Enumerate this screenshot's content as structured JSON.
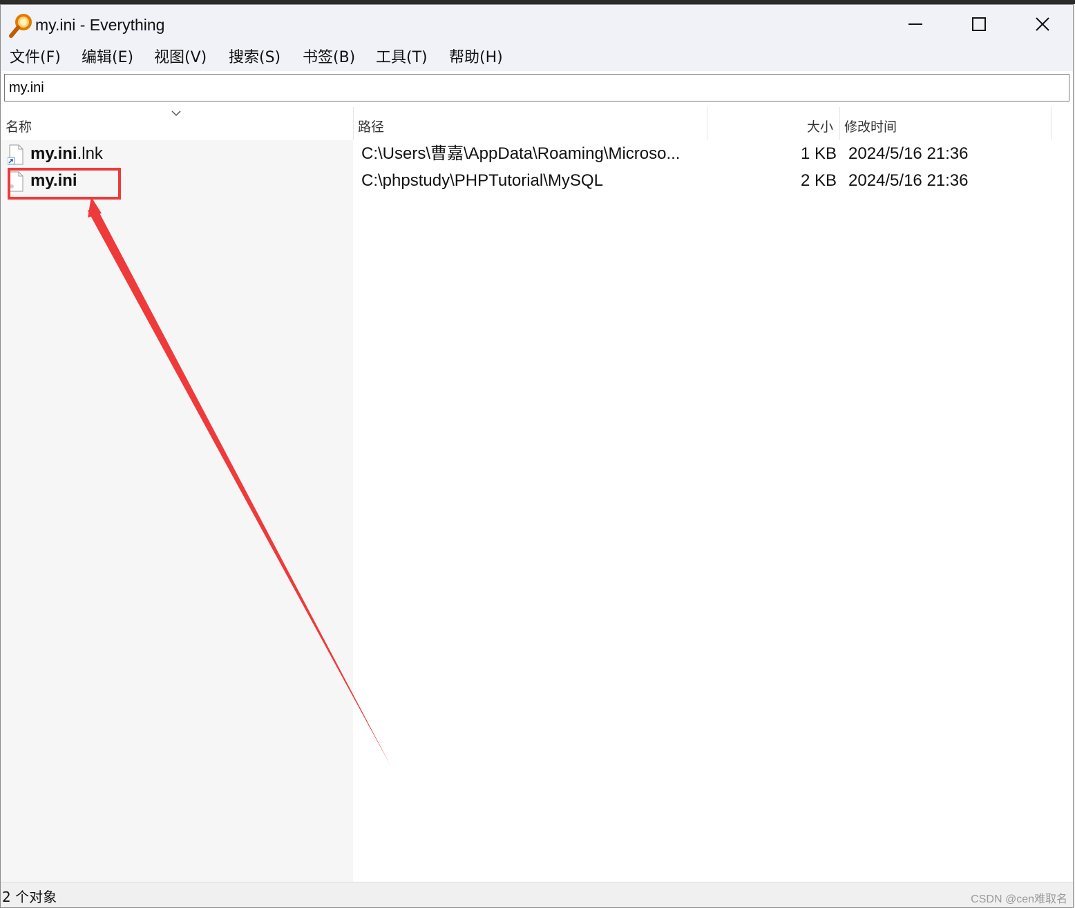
{
  "window": {
    "title": "my.ini - Everything",
    "app_icon": "magnifier-icon",
    "controls": [
      "minimize-icon",
      "maximize-icon",
      "close-icon"
    ]
  },
  "menu": {
    "items": [
      "文件(F)",
      "编辑(E)",
      "视图(V)",
      "搜索(S)",
      "书签(B)",
      "工具(T)",
      "帮助(H)"
    ]
  },
  "search": {
    "value": "my.ini"
  },
  "columns": {
    "name": "名称",
    "path": "路径",
    "size": "大小",
    "modified": "修改时间"
  },
  "rows": [
    {
      "icon": "shortcut-file-icon",
      "name_bold": "my.ini",
      "name_rest": ".lnk",
      "path": "C:\\Users\\曹嘉\\AppData\\Roaming\\Microso...",
      "size": "1 KB",
      "modified": "2024/5/16 21:36"
    },
    {
      "icon": "file-icon",
      "name_bold": "my.ini",
      "name_rest": "",
      "path": "C:\\phpstudy\\PHPTutorial\\MySQL",
      "size": "2 KB",
      "modified": "2024/5/16 21:36"
    }
  ],
  "status": {
    "count_text": "2 个对象",
    "watermark": "CSDN @cen难取名"
  },
  "annotation": {
    "color": "#ee3a3a"
  }
}
